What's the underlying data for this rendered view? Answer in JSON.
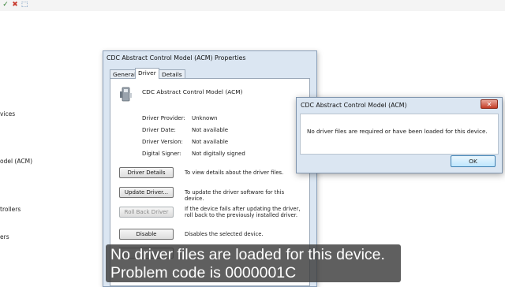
{
  "background": {
    "items": [
      {
        "label": "vices"
      },
      {
        "label": "odel (ACM)"
      },
      {
        "label": "trollers"
      },
      {
        "label": "ers"
      }
    ]
  },
  "properties_dialog": {
    "title": "CDC Abstract Control Model (ACM) Properties",
    "tabs": [
      {
        "label": "General"
      },
      {
        "label": "Driver"
      },
      {
        "label": "Details"
      }
    ],
    "device_name": "CDC Abstract Control Model (ACM)",
    "fields": [
      {
        "label": "Driver Provider:",
        "value": "Unknown"
      },
      {
        "label": "Driver Date:",
        "value": "Not available"
      },
      {
        "label": "Driver Version:",
        "value": "Not available"
      },
      {
        "label": "Digital Signer:",
        "value": "Not digitally signed"
      }
    ],
    "buttons": [
      {
        "label": "Driver Details",
        "description": "To view details about the driver files."
      },
      {
        "label": "Update Driver...",
        "description": "To update the driver software for this device."
      },
      {
        "label": "Roll Back Driver",
        "description": "If the device fails after updating the driver, roll back to the previously installed driver."
      },
      {
        "label": "Disable",
        "description": "Disables the selected device."
      }
    ]
  },
  "message_box": {
    "title": "CDC Abstract Control Model (ACM)",
    "text": "No driver files are required or have been loaded for this device.",
    "ok_label": "OK",
    "close_glyph": "✕"
  },
  "caption": {
    "line1": "No driver files are loaded for this device.",
    "line2": "Problem code is 0000001C"
  },
  "colors": {
    "dialog_frame": "#dbe6f2",
    "caption_bg": "#3c3c3c"
  }
}
